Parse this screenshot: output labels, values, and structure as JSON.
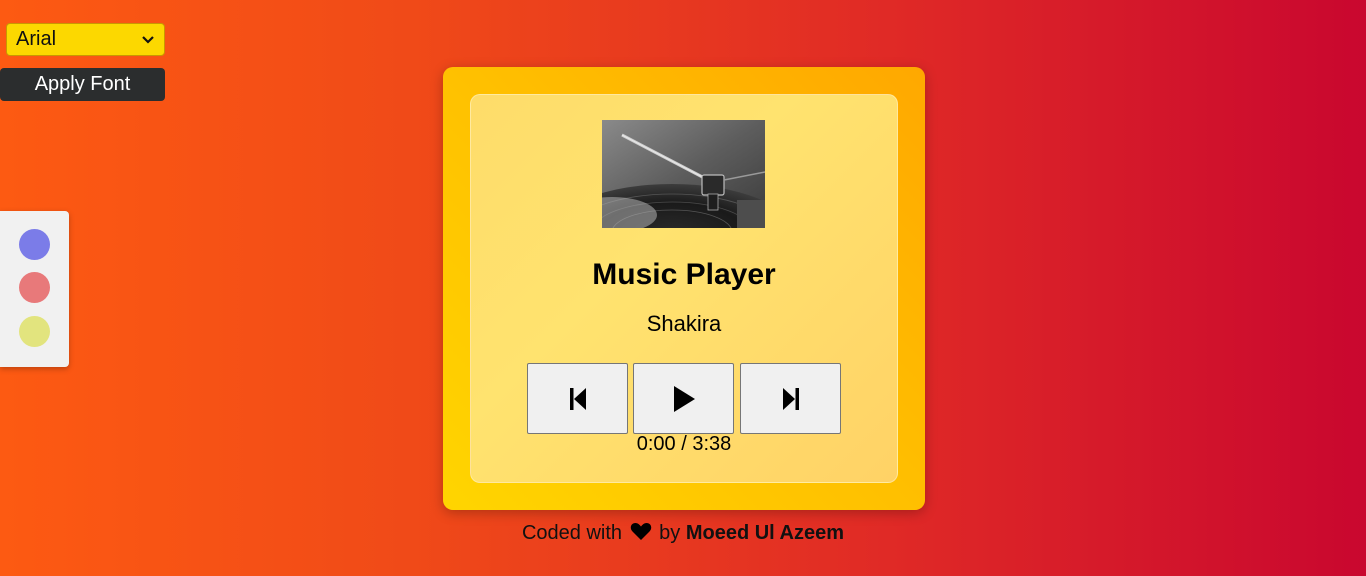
{
  "font_selector": {
    "selected": "Arial",
    "apply_label": "Apply Font"
  },
  "theme_swatches": [
    {
      "name": "blue",
      "color": "#7b7ce8"
    },
    {
      "name": "red",
      "color": "#e8797a"
    },
    {
      "name": "yellow",
      "color": "#e2e47e"
    }
  ],
  "player": {
    "title": "Music Player",
    "artist": "Shakira",
    "current_time": "0:00",
    "duration": "3:38",
    "time_separator": " / ",
    "controls": [
      "prev",
      "play",
      "next"
    ]
  },
  "footer": {
    "prefix": "Coded with",
    "by": "by",
    "author": "Moeed Ul Azeem"
  },
  "colors": {
    "select_bg": "#fcd800",
    "apply_bg": "#2b2d2e",
    "card_accent": "#ffc000"
  }
}
